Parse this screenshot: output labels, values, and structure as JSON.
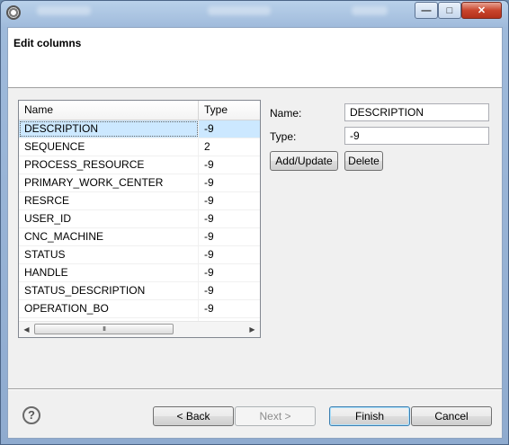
{
  "window": {
    "minimize_glyph": "—",
    "maximize_glyph": "□",
    "close_glyph": "✕"
  },
  "header": {
    "title": "Edit columns"
  },
  "table": {
    "columns": [
      "Name",
      "Type"
    ],
    "rows": [
      {
        "name": "DESCRIPTION",
        "type": "-9"
      },
      {
        "name": "SEQUENCE",
        "type": "2"
      },
      {
        "name": "PROCESS_RESOURCE",
        "type": "-9"
      },
      {
        "name": "PRIMARY_WORK_CENTER",
        "type": "-9"
      },
      {
        "name": "RESRCE",
        "type": "-9"
      },
      {
        "name": "USER_ID",
        "type": "-9"
      },
      {
        "name": "CNC_MACHINE",
        "type": "-9"
      },
      {
        "name": "STATUS",
        "type": "-9"
      },
      {
        "name": "HANDLE",
        "type": "-9"
      },
      {
        "name": "STATUS_DESCRIPTION",
        "type": "-9"
      },
      {
        "name": "OPERATION_BO",
        "type": "-9"
      }
    ],
    "selected_index": 0,
    "scroll": {
      "left_arrow": "◀",
      "right_arrow": "▶",
      "thumb_grip": "III"
    }
  },
  "form": {
    "name_label": "Name:",
    "name_value": "DESCRIPTION",
    "type_label": "Type:",
    "type_value": "-9",
    "add_update_label": "Add/Update",
    "delete_label": "Delete"
  },
  "footer": {
    "help_glyph": "?",
    "back_label": "< Back",
    "next_label": "Next >",
    "finish_label": "Finish",
    "cancel_label": "Cancel"
  }
}
